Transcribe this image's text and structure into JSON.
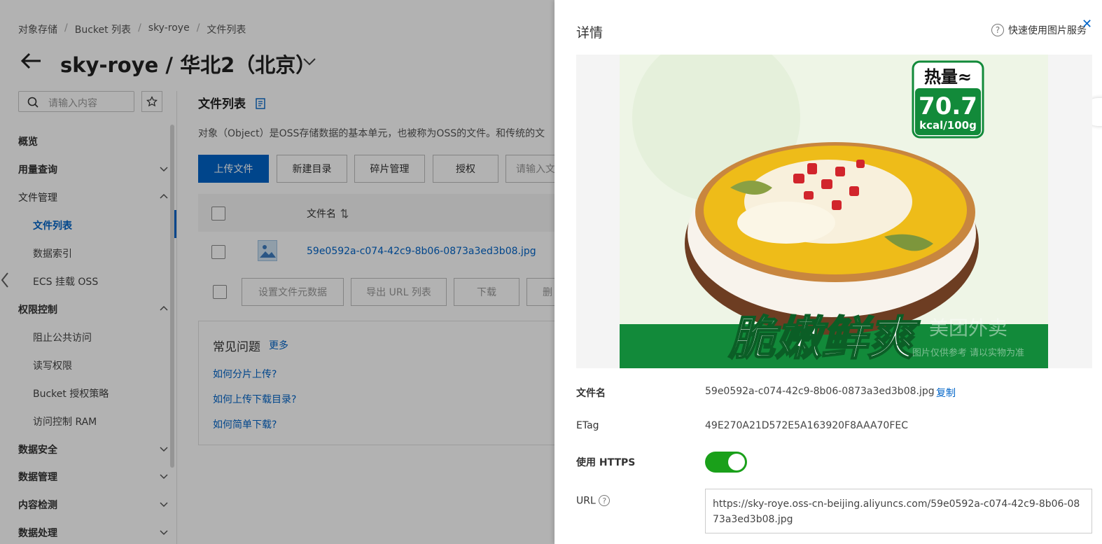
{
  "breadcrumb": [
    "对象存储",
    "Bucket 列表",
    "sky-roye",
    "文件列表"
  ],
  "header": {
    "title": "sky-roye / 华北2（北京）"
  },
  "search": {
    "placeholder": "请输入内容"
  },
  "nav": {
    "items": [
      {
        "label": "概览"
      },
      {
        "label": "用量查询"
      },
      {
        "label": "文件管理"
      },
      {
        "label": "文件列表"
      },
      {
        "label": "数据索引"
      },
      {
        "label": "ECS 挂载 OSS"
      },
      {
        "label": "权限控制"
      },
      {
        "label": "阻止公共访问"
      },
      {
        "label": "读写权限"
      },
      {
        "label": "Bucket 授权策略"
      },
      {
        "label": "访问控制 RAM"
      },
      {
        "label": "数据安全"
      },
      {
        "label": "数据管理"
      },
      {
        "label": "内容检测"
      },
      {
        "label": "数据处理"
      }
    ]
  },
  "main": {
    "title": "文件列表",
    "description": "对象（Object）是OSS存储数据的基本单元，也被称为OSS的文件。和传统的文",
    "buttons": {
      "upload": "上传文件",
      "new_dir": "新建目录",
      "fragments": "碎片管理",
      "authorize": "授权",
      "search_placeholder": "请输入文"
    },
    "table": {
      "col_filename": "文件名",
      "row_filename": "59e0592a-c074-42c9-8b06-0873a3ed3b08.jpg"
    },
    "bulk": {
      "set_meta": "设置文件元数据",
      "export_url": "导出 URL 列表",
      "download": "下载",
      "more": "删"
    },
    "faq": {
      "title": "常见问题",
      "more": "更多",
      "q1": "如何分片上传?",
      "q2": "如何上传下载目录?",
      "q3": "如何简单下载?"
    }
  },
  "panel": {
    "title": "详情",
    "help": "快速使用图片服务",
    "image_text": {
      "badge_top": "热量≈",
      "badge_value": "70.7",
      "badge_unit": "kcal/100g",
      "banner": "脆嫩鲜爽",
      "watermark": "美团外卖",
      "disclaimer": "图片仅供参考 请以实物为准"
    },
    "fields": {
      "filename_label": "文件名",
      "filename_value": "59e0592a-c074-42c9-8b06-0873a3ed3b08.jpg",
      "copy": "复制",
      "etag_label": "ETag",
      "etag_value": "49E270A21D572E5A163920F8AAA70FEC",
      "https_label": "使用 HTTPS",
      "https_enabled": true,
      "url_label": "URL",
      "url_value": "https://sky-roye.oss-cn-beijing.aliyuncs.com/59e0592a-c074-42c9-8b06-0873a3ed3b08.jpg"
    }
  }
}
